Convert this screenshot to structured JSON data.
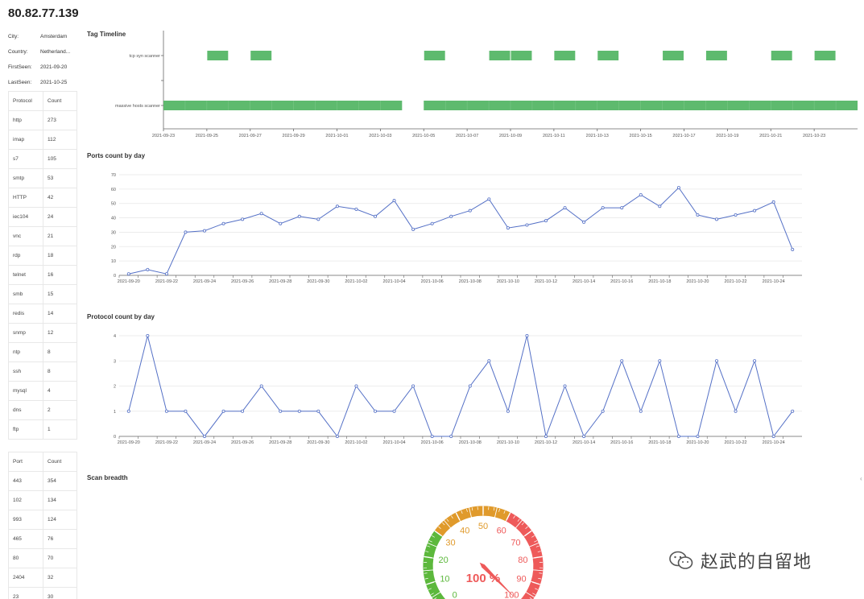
{
  "ip": "80.82.77.139",
  "info": [
    {
      "key": "City:",
      "value": "Amsterdam"
    },
    {
      "key": "Country:",
      "value": "Netherland..."
    },
    {
      "key": "FirstSeen:",
      "value": "2021-09-20"
    },
    {
      "key": "LastSeen:",
      "value": "2021-10-25"
    }
  ],
  "protocol_table": {
    "headers": [
      "Protocol",
      "Count"
    ],
    "rows": [
      [
        "http",
        "273"
      ],
      [
        "imap",
        "112"
      ],
      [
        "s7",
        "105"
      ],
      [
        "smtp",
        "53"
      ],
      [
        "HTTP",
        "42"
      ],
      [
        "iec104",
        "24"
      ],
      [
        "vnc",
        "21"
      ],
      [
        "rdp",
        "18"
      ],
      [
        "telnet",
        "16"
      ],
      [
        "smb",
        "15"
      ],
      [
        "redis",
        "14"
      ],
      [
        "snmp",
        "12"
      ],
      [
        "ntp",
        "8"
      ],
      [
        "ssh",
        "8"
      ],
      [
        "mysql",
        "4"
      ],
      [
        "dns",
        "2"
      ],
      [
        "ftp",
        "1"
      ]
    ]
  },
  "port_table": {
    "headers": [
      "Port",
      "Count"
    ],
    "rows": [
      [
        "443",
        "354"
      ],
      [
        "102",
        "134"
      ],
      [
        "993",
        "124"
      ],
      [
        "465",
        "76"
      ],
      [
        "80",
        "70"
      ],
      [
        "2404",
        "32"
      ],
      [
        "23",
        "30"
      ]
    ]
  },
  "sections": {
    "tag_timeline": "Tag Timeline",
    "ports_by_day": "Ports count by day",
    "protocol_by_day": "Protocol count by day",
    "scan_breadth": "Scan breadth"
  },
  "watermark": "赵武的自留地",
  "colors": {
    "bar": "#5eba6e",
    "line": "#5470c6",
    "green": "#5cb83c",
    "orange": "#e09a2b",
    "red": "#ee5a5a"
  },
  "chart_data": [
    {
      "type": "timeline",
      "title": "Tag Timeline",
      "tick_labels": [
        "2021-09-23",
        "2021-09-25",
        "2021-09-27",
        "2021-09-29",
        "2021-10-01",
        "2021-10-03",
        "2021-10-05",
        "2021-10-07",
        "2021-10-09",
        "2021-10-11",
        "2021-10-13",
        "2021-10-15",
        "2021-10-17",
        "2021-10-19",
        "2021-10-21",
        "2021-10-23"
      ],
      "categories": [
        "tcp syn scanner",
        "massive hosts scanner"
      ],
      "series": [
        {
          "name": "tcp syn scanner",
          "dates": [
            "2021-09-25",
            "2021-09-27",
            "2021-10-05",
            "2021-10-08",
            "2021-10-09",
            "2021-10-11",
            "2021-10-13",
            "2021-10-16",
            "2021-10-18",
            "2021-10-21",
            "2021-10-23"
          ]
        },
        {
          "name": "massive hosts scanner",
          "ranges": [
            [
              "2021-09-23",
              "2021-10-04"
            ],
            [
              "2021-10-05",
              "2021-10-25"
            ]
          ]
        }
      ]
    },
    {
      "type": "line",
      "title": "Ports count by day",
      "x": [
        "2021-09-20",
        "2021-09-21",
        "2021-09-22",
        "2021-09-23",
        "2021-09-24",
        "2021-09-25",
        "2021-09-26",
        "2021-09-27",
        "2021-09-28",
        "2021-09-29",
        "2021-09-30",
        "2021-10-01",
        "2021-10-02",
        "2021-10-03",
        "2021-10-04",
        "2021-10-05",
        "2021-10-06",
        "2021-10-07",
        "2021-10-08",
        "2021-10-09",
        "2021-10-10",
        "2021-10-11",
        "2021-10-12",
        "2021-10-13",
        "2021-10-14",
        "2021-10-15",
        "2021-10-16",
        "2021-10-17",
        "2021-10-18",
        "2021-10-19",
        "2021-10-20",
        "2021-10-21",
        "2021-10-22",
        "2021-10-23",
        "2021-10-24",
        "2021-10-25"
      ],
      "tick_labels": [
        "2021-09-20",
        "2021-09-22",
        "2021-09-24",
        "2021-09-26",
        "2021-09-28",
        "2021-09-30",
        "2021-10-02",
        "2021-10-04",
        "2021-10-06",
        "2021-10-08",
        "2021-10-10",
        "2021-10-12",
        "2021-10-14",
        "2021-10-16",
        "2021-10-18",
        "2021-10-20",
        "2021-10-22",
        "2021-10-24"
      ],
      "values": [
        1,
        4,
        1,
        30,
        31,
        36,
        39,
        43,
        36,
        41,
        39,
        48,
        46,
        41,
        52,
        32,
        36,
        41,
        45,
        53,
        33,
        35,
        38,
        47,
        37,
        47,
        47,
        56,
        48,
        61,
        42,
        39,
        42,
        45,
        51,
        18
      ],
      "ylim": [
        0,
        70
      ],
      "yticks": [
        0,
        10,
        20,
        30,
        40,
        50,
        60,
        70
      ],
      "grid": true
    },
    {
      "type": "line",
      "title": "Protocol count by day",
      "x": [
        "2021-09-20",
        "2021-09-21",
        "2021-09-22",
        "2021-09-23",
        "2021-09-24",
        "2021-09-25",
        "2021-09-26",
        "2021-09-27",
        "2021-09-28",
        "2021-09-29",
        "2021-09-30",
        "2021-10-01",
        "2021-10-02",
        "2021-10-03",
        "2021-10-04",
        "2021-10-05",
        "2021-10-06",
        "2021-10-07",
        "2021-10-08",
        "2021-10-09",
        "2021-10-10",
        "2021-10-11",
        "2021-10-12",
        "2021-10-13",
        "2021-10-14",
        "2021-10-15",
        "2021-10-16",
        "2021-10-17",
        "2021-10-18",
        "2021-10-19",
        "2021-10-20",
        "2021-10-21",
        "2021-10-22",
        "2021-10-23",
        "2021-10-24",
        "2021-10-25"
      ],
      "tick_labels": [
        "2021-09-20",
        "2021-09-22",
        "2021-09-24",
        "2021-09-26",
        "2021-09-28",
        "2021-09-30",
        "2021-10-02",
        "2021-10-04",
        "2021-10-06",
        "2021-10-08",
        "2021-10-10",
        "2021-10-12",
        "2021-10-14",
        "2021-10-16",
        "2021-10-18",
        "2021-10-20",
        "2021-10-22",
        "2021-10-24"
      ],
      "values": [
        1,
        4,
        1,
        1,
        0,
        1,
        1,
        2,
        1,
        1,
        1,
        0,
        2,
        1,
        1,
        2,
        0,
        0,
        2,
        3,
        1,
        4,
        0,
        2,
        0,
        1,
        3,
        1,
        3,
        0,
        0,
        3,
        1,
        3,
        0,
        1
      ],
      "ylim": [
        0,
        4
      ],
      "yticks": [
        0,
        1,
        2,
        3,
        4
      ],
      "grid": true
    },
    {
      "type": "gauge",
      "title": "Scan breadth",
      "value": 100,
      "value_label": "100 %",
      "min": 0,
      "max": 100,
      "tick_labels": [
        "0",
        "10",
        "20",
        "30",
        "40",
        "50",
        "60",
        "70",
        "80",
        "90",
        "100"
      ]
    }
  ]
}
